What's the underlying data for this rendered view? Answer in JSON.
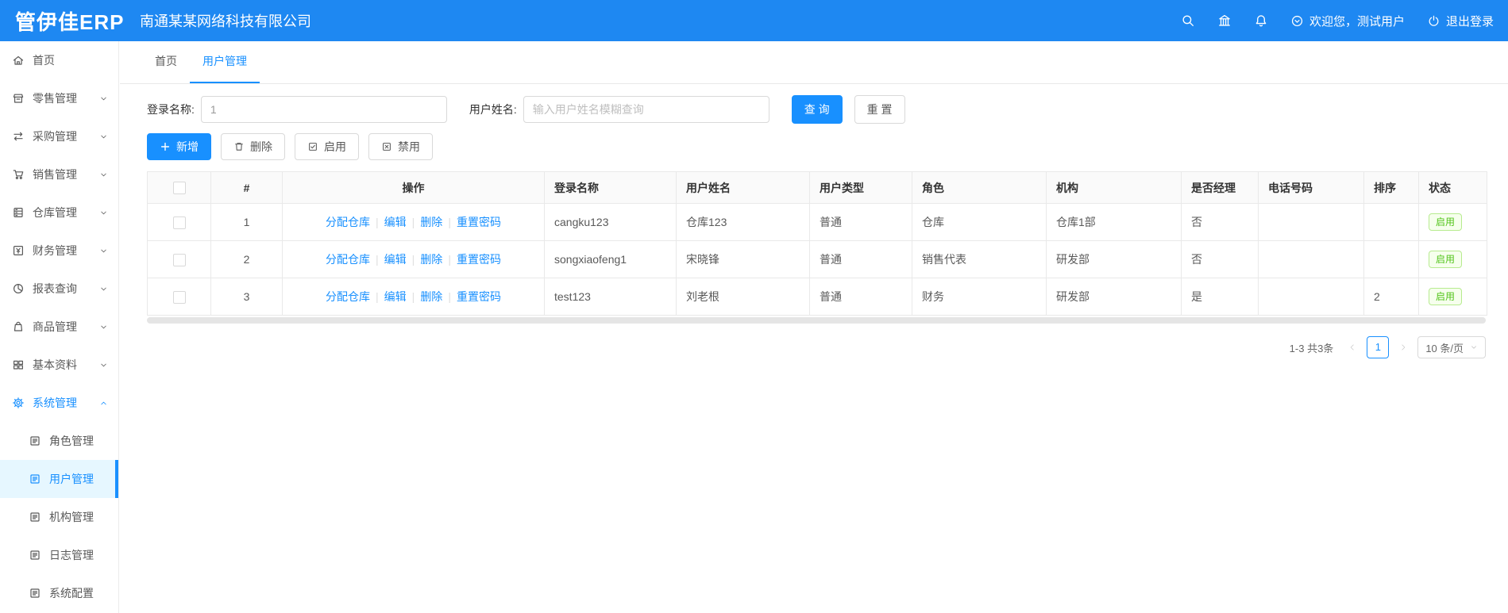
{
  "colors": {
    "primary": "#1890ff",
    "header_bg": "#1e88f2",
    "success": "#52c41a"
  },
  "header": {
    "logo": "管伊佳ERP",
    "company": "南通某某网络科技有限公司",
    "welcome": "欢迎您，测试用户",
    "logout": "退出登录"
  },
  "sidebar": {
    "items": [
      {
        "label": "首页"
      },
      {
        "label": "零售管理"
      },
      {
        "label": "采购管理"
      },
      {
        "label": "销售管理"
      },
      {
        "label": "仓库管理"
      },
      {
        "label": "财务管理"
      },
      {
        "label": "报表查询"
      },
      {
        "label": "商品管理"
      },
      {
        "label": "基本资料"
      },
      {
        "label": "系统管理"
      }
    ],
    "sub_items": [
      {
        "label": "角色管理"
      },
      {
        "label": "用户管理"
      },
      {
        "label": "机构管理"
      },
      {
        "label": "日志管理"
      },
      {
        "label": "系统配置"
      }
    ]
  },
  "tabs": [
    {
      "label": "首页"
    },
    {
      "label": "用户管理"
    }
  ],
  "search": {
    "login_label": "登录名称:",
    "login_value": "1",
    "name_label": "用户姓名:",
    "name_placeholder": "输入用户姓名模糊查询",
    "query": "查 询",
    "reset": "重 置"
  },
  "toolbar": {
    "add": "新增",
    "delete": "删除",
    "enable": "启用",
    "disable": "禁用"
  },
  "table": {
    "headers": [
      "#",
      "操作",
      "登录名称",
      "用户姓名",
      "用户类型",
      "角色",
      "机构",
      "是否经理",
      "电话号码",
      "排序",
      "状态"
    ],
    "op_links": [
      "分配仓库",
      "编辑",
      "删除",
      "重置密码"
    ],
    "op_separator": "|",
    "rows": [
      {
        "index": "1",
        "login": "cangku123",
        "name": "仓库123",
        "type": "普通",
        "role": "仓库",
        "org": "仓库1部",
        "manager": "否",
        "phone": "",
        "sort": "",
        "status": "启用"
      },
      {
        "index": "2",
        "login": "songxiaofeng1",
        "name": "宋晓锋",
        "type": "普通",
        "role": "销售代表",
        "org": "研发部",
        "manager": "否",
        "phone": "",
        "sort": "",
        "status": "启用"
      },
      {
        "index": "3",
        "login": "test123",
        "name": "刘老根",
        "type": "普通",
        "role": "财务",
        "org": "研发部",
        "manager": "是",
        "phone": "",
        "sort": "2",
        "status": "启用"
      }
    ]
  },
  "pagination": {
    "total": "1-3 共3条",
    "page": "1",
    "size": "10 条/页"
  }
}
